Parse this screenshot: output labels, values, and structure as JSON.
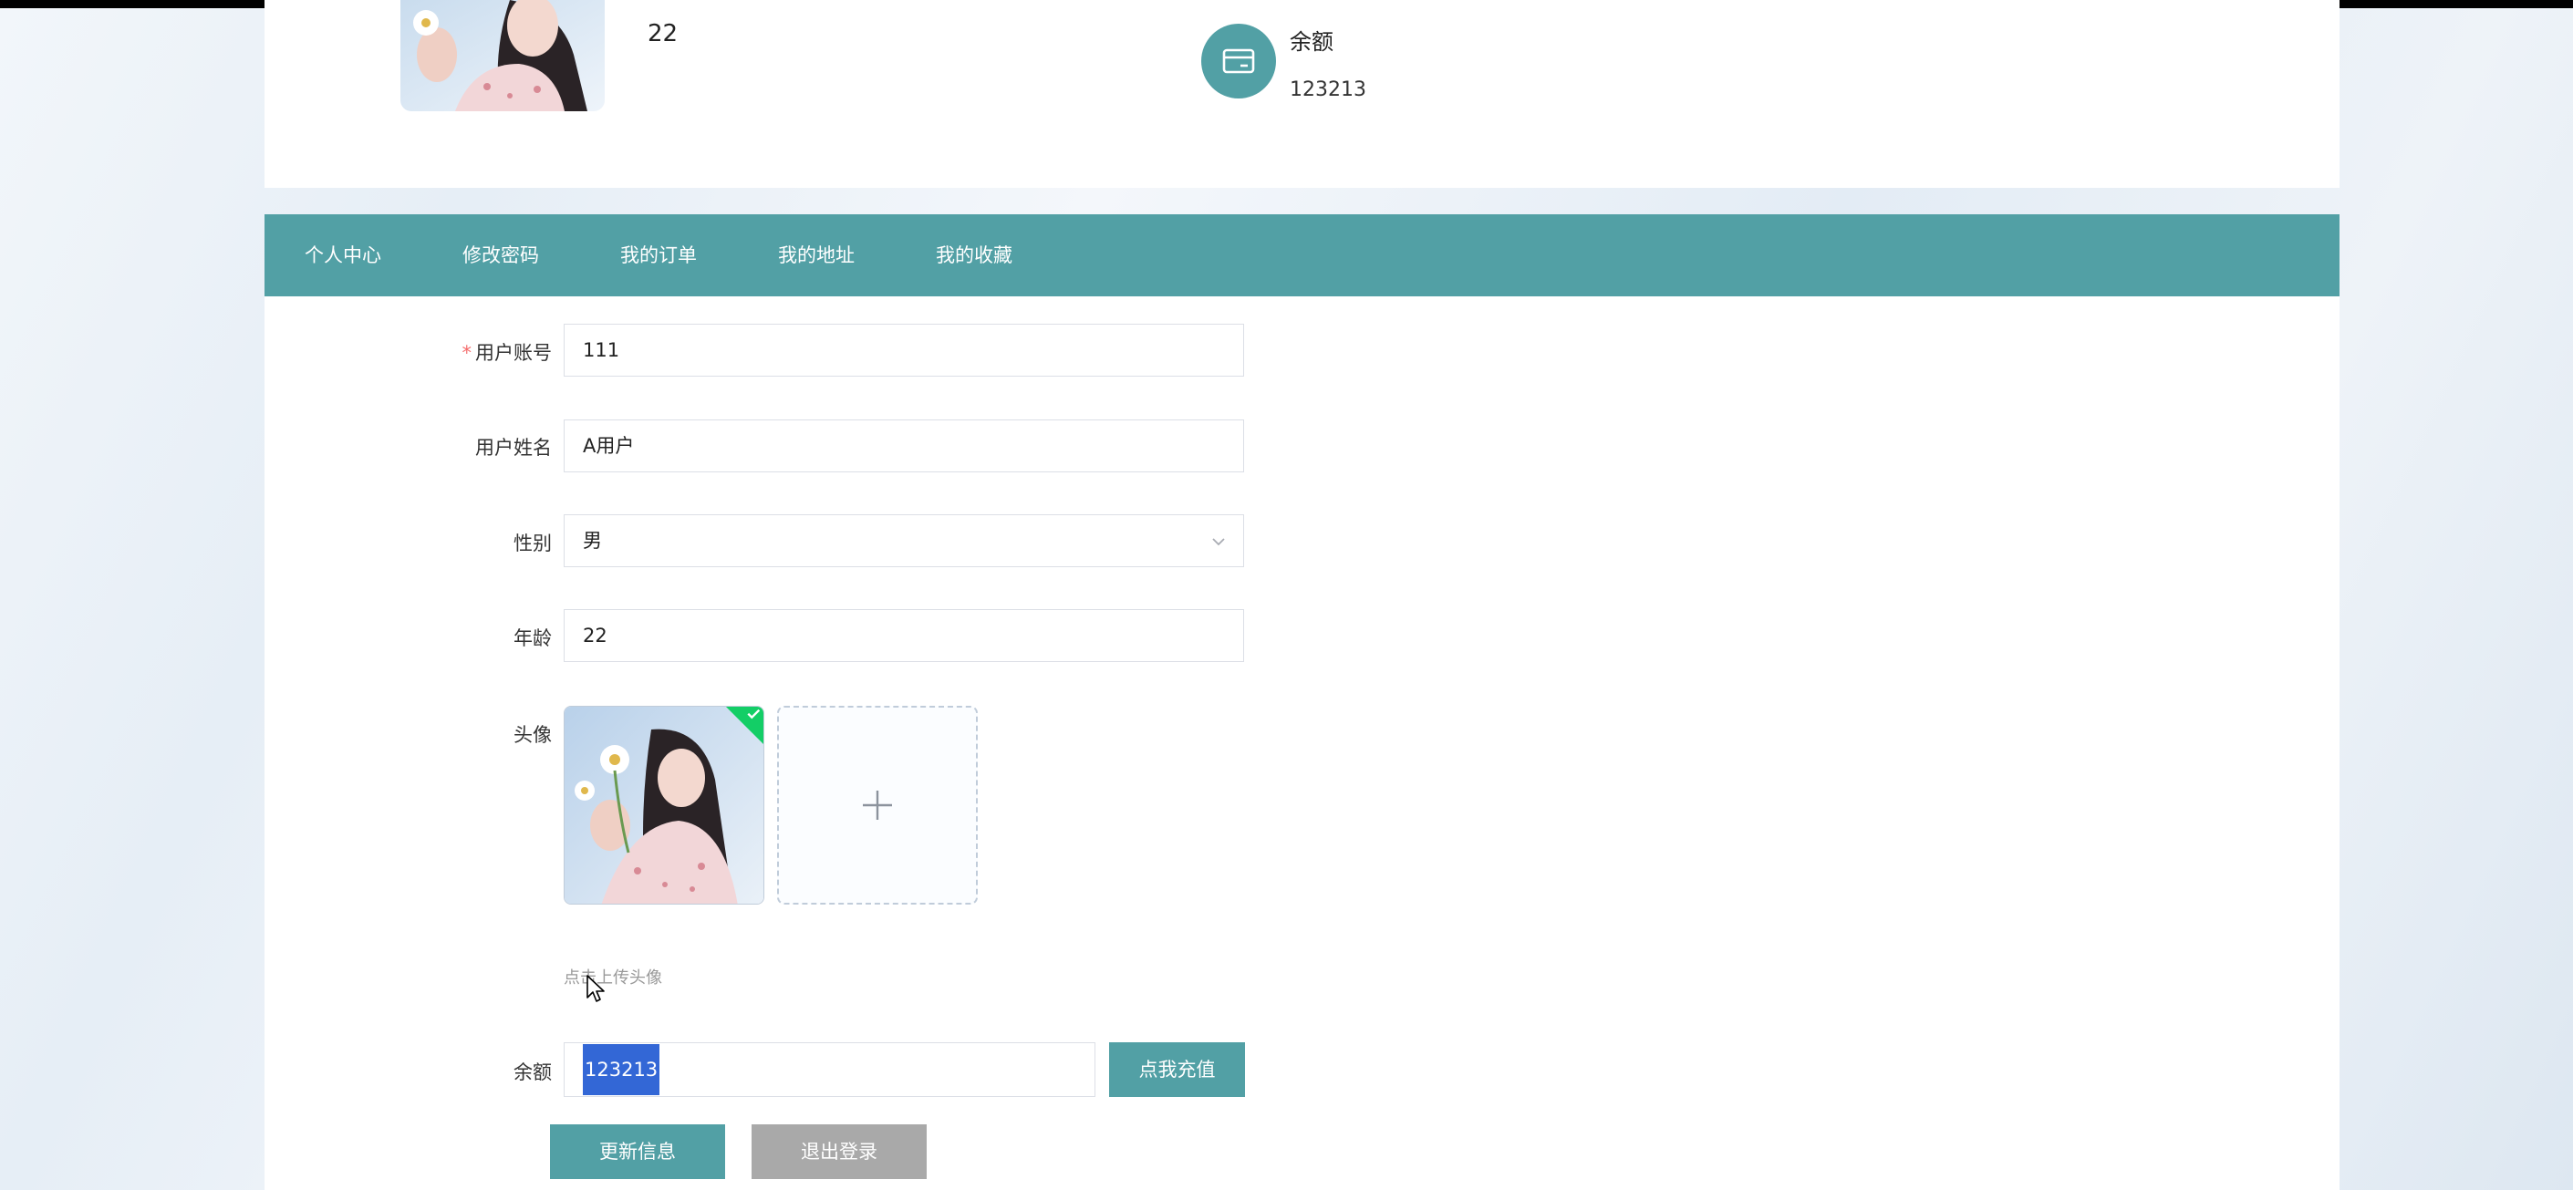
{
  "header": {
    "age_value": "22",
    "balance_label": "余额",
    "balance_value": "123213"
  },
  "nav": {
    "items": [
      "个人中心",
      "修改密码",
      "我的订单",
      "我的地址",
      "我的收藏"
    ]
  },
  "form": {
    "account_label": "用户账号",
    "account_value": "111",
    "name_label": "用户姓名",
    "name_value": "A用户",
    "gender_label": "性别",
    "gender_value": "男",
    "age_label": "年龄",
    "age_value": "22",
    "avatar_label": "头像",
    "upload_hint": "点击上传头像",
    "balance_label": "余额",
    "balance_value": "123213",
    "charge_button": "点我充值",
    "update_button": "更新信息",
    "logout_button": "退出登录"
  },
  "colors": {
    "accent": "#52a0a5",
    "required": "#f56c6c",
    "success": "#13ce66",
    "selection": "#3367d6",
    "logout": "#a9a9a9"
  },
  "icons": {
    "balance": "wallet-icon",
    "dropdown": "chevron-down-icon",
    "upload": "plus-icon",
    "success": "check-icon"
  }
}
